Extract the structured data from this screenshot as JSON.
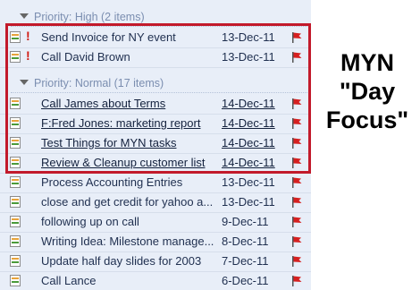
{
  "groups": [
    {
      "header": "Priority: High (2 items)",
      "tasks": [
        {
          "subject": "Send Invoice for NY event",
          "due": "13-Dec-11",
          "important": true,
          "underline": false
        },
        {
          "subject": "Call David Brown",
          "due": "13-Dec-11",
          "important": true,
          "underline": false
        }
      ]
    },
    {
      "header": "Priority: Normal (17 items)",
      "tasks": [
        {
          "subject": "Call James about Terms",
          "due": "14-Dec-11",
          "important": false,
          "underline": true
        },
        {
          "subject": "F:Fred Jones: marketing report",
          "due": "14-Dec-11",
          "important": false,
          "underline": true
        },
        {
          "subject": "Test Things for MYN tasks",
          "due": "14-Dec-11",
          "important": false,
          "underline": true
        },
        {
          "subject": "Review & Cleanup customer list",
          "due": "14-Dec-11",
          "important": false,
          "underline": true
        },
        {
          "subject": "Process Accounting Entries",
          "due": "13-Dec-11",
          "important": false,
          "underline": false
        },
        {
          "subject": "close and get credit for yahoo a...",
          "due": "13-Dec-11",
          "important": false,
          "underline": false
        },
        {
          "subject": "following up on call",
          "due": "9-Dec-11",
          "important": false,
          "underline": false
        },
        {
          "subject": "Writing Idea: Milestone manage...",
          "due": "8-Dec-11",
          "important": false,
          "underline": false
        },
        {
          "subject": "Update half day slides for 2003",
          "due": "7-Dec-11",
          "important": false,
          "underline": false
        },
        {
          "subject": "Call Lance",
          "due": "6-Dec-11",
          "important": false,
          "underline": false
        }
      ]
    }
  ],
  "callout": {
    "line1": "MYN",
    "line2": "\"Day",
    "line3": "Focus\""
  },
  "icons": {
    "task": "task-icon",
    "flag": "red-flag-icon",
    "importance": "high-importance-icon"
  },
  "colors": {
    "flag": "#d62020",
    "highlight_border": "#c21a2b",
    "list_background": "#e8eef8"
  }
}
